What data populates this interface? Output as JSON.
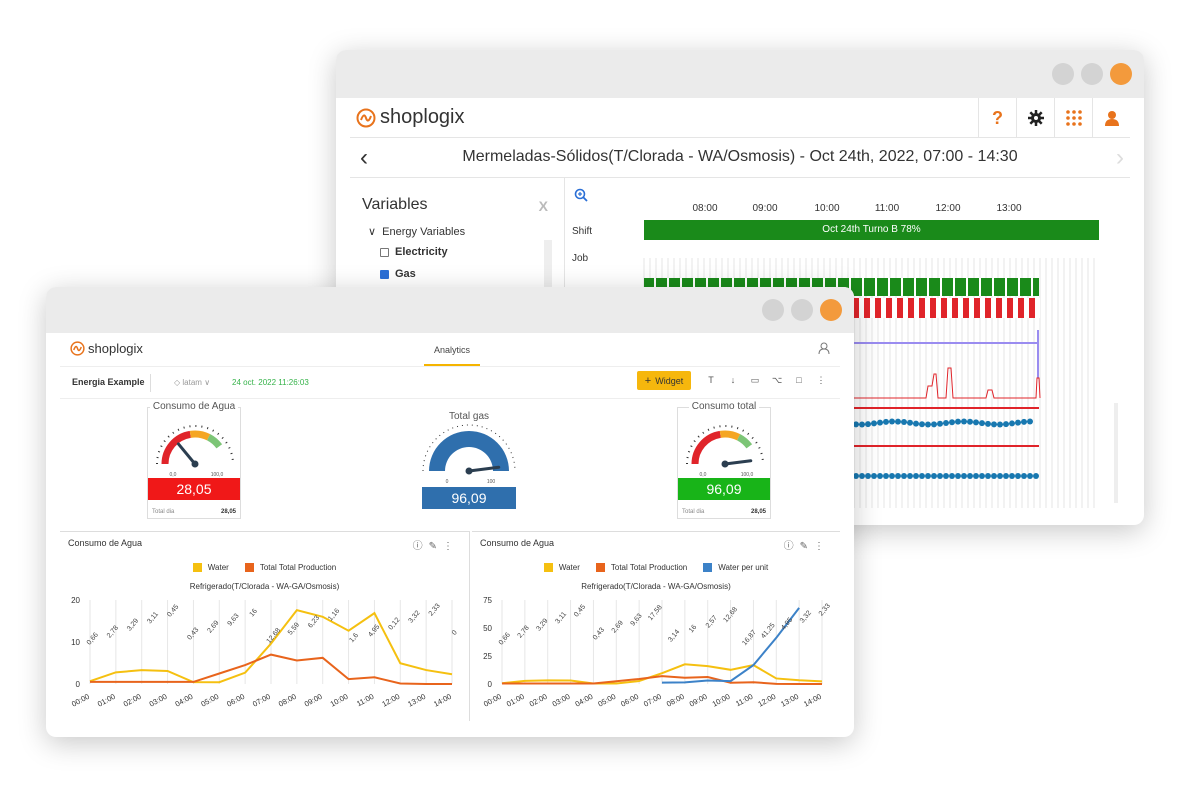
{
  "back": {
    "logo": "shoplogix",
    "tools": [
      "?",
      "gear",
      "apps",
      "user"
    ],
    "title": "Mermeladas-Sólidos(T/Clorada - WA/Osmosis) - Oct 24th, 2022, 07:00 - 14:30",
    "sidebar": {
      "title": "Variables",
      "close": "X",
      "group": "Energy Variables",
      "items": [
        {
          "label": "Electricity",
          "checked": false
        },
        {
          "label": "Gas",
          "checked": true
        }
      ]
    },
    "rows": {
      "shift": "Shift",
      "job": "Job"
    },
    "hours": [
      "08:00",
      "09:00",
      "10:00",
      "11:00",
      "12:00",
      "13:00"
    ],
    "shift_bar": "Oct 24th Turno B 78%",
    "colors": {
      "green": "#1a8a1a",
      "red": "#e0242a",
      "purple": "#9a8cf0",
      "blue": "#1878b0"
    }
  },
  "front": {
    "logo": "shoplogix",
    "tab": "Analytics",
    "dashboard": "Energia Example",
    "location": "latam",
    "timestamp": "24 oct. 2022 11:26:03",
    "widget_button": "Widget",
    "gauges": [
      {
        "title": "Consumo de Agua",
        "value": "28,05",
        "min": "0,0",
        "max": "100,0",
        "foot_label": "Total dia",
        "foot_value": "28,05",
        "color": "#f01818",
        "level": 0.28
      },
      {
        "title": "Total gas",
        "value": "96,09",
        "min": "0",
        "max": "100",
        "color": "#2f6fad",
        "level": 0.96
      },
      {
        "title": "Consumo total",
        "value": "96,09",
        "min": "0,0",
        "max": "100,0",
        "foot_label": "Total dia",
        "foot_value": "28,05",
        "color": "#18b418",
        "level": 0.96
      }
    ],
    "panels": [
      {
        "title": "Consumo de Agua",
        "legend": [
          "Water",
          "Total Total Production"
        ]
      },
      {
        "title": "Consumo de Agua",
        "legend": [
          "Water",
          "Total Total Production",
          "Water per unit"
        ]
      }
    ]
  },
  "chart_data": [
    {
      "type": "line",
      "title": "Refrigerado(T/Clorada - WA-GA/Osmosis)",
      "x": [
        "00:00",
        "01:00",
        "02:00",
        "03:00",
        "04:00",
        "05:00",
        "06:00",
        "07:00",
        "08:00",
        "09:00",
        "10:00",
        "11:00",
        "12:00",
        "13:00",
        "14:00"
      ],
      "ylim": [
        0,
        20
      ],
      "yticks": [
        0,
        10,
        20
      ],
      "series": [
        {
          "name": "Water",
          "color": "#f5c010",
          "values": [
            0.66,
            2.78,
            3.29,
            3.11,
            0.45,
            0.43,
            2.69,
            9.63,
            17.58,
            16,
            12.68,
            16.87,
            4.95,
            3.32,
            2.33
          ]
        },
        {
          "name": "Total Total Production",
          "color": "#e8641c",
          "values": [
            0.5,
            0.5,
            0.5,
            0.5,
            0.5,
            2.5,
            4.5,
            7,
            5.59,
            6.23,
            1.16,
            1.6,
            0.12,
            0,
            0
          ]
        }
      ],
      "data_labels": [
        "0,66",
        "2,78",
        "3,29",
        "3,11",
        "0,45",
        "0,43",
        "2,69",
        "9,63",
        "16",
        "12,68",
        "5,59",
        "6,23",
        "1,16",
        "1,6",
        "4,95",
        "0,12",
        "3,32",
        "2,33",
        "0"
      ]
    },
    {
      "type": "line",
      "title": "Refrigerado(T/Clorada - WA-GA/Osmosis)",
      "x": [
        "00:00",
        "01:00",
        "02:00",
        "03:00",
        "04:00",
        "05:00",
        "06:00",
        "07:00",
        "08:00",
        "09:00",
        "10:00",
        "11:00",
        "12:00",
        "13:00",
        "14:00"
      ],
      "ylim": [
        0,
        75
      ],
      "yticks": [
        0,
        25,
        50,
        75
      ],
      "series": [
        {
          "name": "Water",
          "color": "#f5c010",
          "values": [
            0.66,
            2.78,
            3.29,
            3.11,
            0.45,
            0.43,
            2.69,
            9.63,
            17.58,
            16,
            12.68,
            16.87,
            4.95,
            3.32,
            2.33
          ]
        },
        {
          "name": "Total Total Production",
          "color": "#e8641c",
          "values": [
            0.5,
            0.5,
            0.5,
            0.5,
            0.5,
            2.5,
            4.5,
            7,
            5.59,
            6.23,
            1.16,
            1.6,
            0.12,
            0,
            0
          ]
        },
        {
          "name": "Water per unit",
          "color": "#3c82c8",
          "values": [
            null,
            null,
            null,
            null,
            null,
            null,
            null,
            1.2,
            1.5,
            3.14,
            2.57,
            16.87,
            41.25,
            68,
            null
          ]
        }
      ],
      "data_labels": [
        "0,66",
        "2,78",
        "3,29",
        "3,11",
        "0,45",
        "0,43",
        "2,69",
        "9,63",
        "17,58",
        "3,14",
        "16",
        "2,57",
        "12,68",
        "16,87",
        "41,25",
        "4,95",
        "3,32",
        "2,33"
      ]
    }
  ]
}
